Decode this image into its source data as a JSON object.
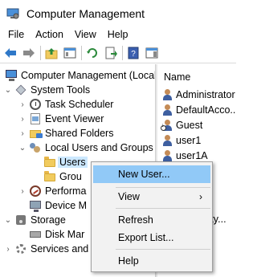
{
  "window": {
    "title": "Computer Management"
  },
  "menu": [
    "File",
    "Action",
    "View",
    "Help"
  ],
  "toolbar": {
    "buttons": [
      "back-arrow-icon",
      "forward-arrow-icon",
      "up-folder-icon",
      "show-hide-tree-icon",
      "refresh-icon",
      "export-icon",
      "help-book-icon",
      "show-hide-action-pane-icon"
    ]
  },
  "tree": [
    {
      "label": "Computer Management (Local",
      "expander": "",
      "icon": "computer-icon"
    },
    {
      "label": "System Tools",
      "expander": "⌄",
      "icon": "tools-icon"
    },
    {
      "label": "Task Scheduler",
      "expander": "›",
      "icon": "clock-icon"
    },
    {
      "label": "Event Viewer",
      "expander": "›",
      "icon": "event-viewer-icon"
    },
    {
      "label": "Shared Folders",
      "expander": "›",
      "icon": "shared-folder-icon"
    },
    {
      "label": "Local Users and Groups",
      "expander": "⌄",
      "icon": "users-groups-icon"
    },
    {
      "label": "Users",
      "expander": "",
      "icon": "folder-icon",
      "selected": true
    },
    {
      "label": "Grou",
      "expander": "",
      "icon": "folder-icon"
    },
    {
      "label": "Performa",
      "expander": "›",
      "icon": "performance-icon"
    },
    {
      "label": "Device M",
      "expander": "",
      "icon": "device-manager-icon"
    },
    {
      "label": "Storage",
      "expander": "⌄",
      "icon": "storage-icon"
    },
    {
      "label": "Disk Mar",
      "expander": "",
      "icon": "disk-icon"
    },
    {
      "label": "Services and",
      "expander": "›",
      "icon": "services-icon"
    }
  ],
  "list": {
    "header": "Name",
    "rows": [
      {
        "name": "Administrator",
        "icon": "user-icon"
      },
      {
        "name": "DefaultAcco...",
        "icon": "user-icon"
      },
      {
        "name": "Guest",
        "icon": "user-disabled-icon"
      },
      {
        "name": "user1",
        "icon": "user-icon"
      },
      {
        "name": "user1A",
        "icon": "user-icon"
      }
    ],
    "partial_text": "ility..."
  },
  "context_menu": {
    "items": [
      {
        "label": "New User...",
        "highlighted": true,
        "submenu": false
      },
      {
        "label": "View",
        "highlighted": false,
        "submenu": true
      },
      {
        "label": "Refresh",
        "highlighted": false,
        "submenu": false
      },
      {
        "label": "Export List...",
        "highlighted": false,
        "submenu": false
      },
      {
        "label": "Help",
        "highlighted": false,
        "submenu": false
      }
    ],
    "submenu_glyph": "›"
  },
  "colors": {
    "selection": "#cce8ff",
    "menu_highlight": "#91c9f7",
    "menu_background": "#f2f2f2"
  }
}
